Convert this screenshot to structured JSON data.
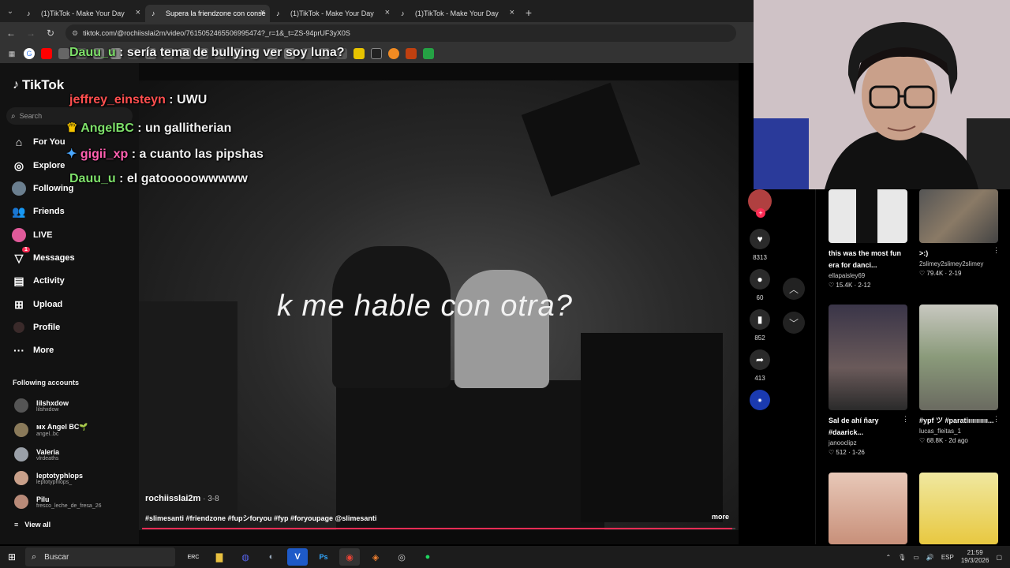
{
  "browser": {
    "tabs": [
      {
        "label": "(1)TikTok - Make Your Day",
        "active": false
      },
      {
        "label": "Supera la friendzone con conse",
        "active": true
      },
      {
        "label": "(1)TikTok - Make Your Day",
        "active": false
      },
      {
        "label": "(1)TikTok - Make Your Day",
        "active": false
      }
    ],
    "url": "tiktok.com/@rochiisslai2m/video/7615052465506995474?_r=1&_t=ZS-94prUF3yX0S"
  },
  "sidebar": {
    "logo": "TikTok",
    "search_placeholder": "Search",
    "nav": [
      {
        "label": "For You",
        "icon": "home-icon"
      },
      {
        "label": "Explore",
        "icon": "compass-icon"
      },
      {
        "label": "Following",
        "icon": "following-avatar-icon"
      },
      {
        "label": "Friends",
        "icon": "friends-icon"
      },
      {
        "label": "LIVE",
        "icon": "live-icon"
      },
      {
        "label": "Messages",
        "icon": "messages-icon",
        "badge": "1"
      },
      {
        "label": "Activity",
        "icon": "activity-icon"
      },
      {
        "label": "Upload",
        "icon": "upload-icon"
      },
      {
        "label": "Profile",
        "icon": "profile-icon"
      },
      {
        "label": "More",
        "icon": "more-dots-icon"
      }
    ],
    "following_header": "Following accounts",
    "accounts": [
      {
        "name": "lilshxdow",
        "handle": "lilshxdow"
      },
      {
        "name": "ᴍx Angel BC🌱",
        "handle": "angel..bc"
      },
      {
        "name": "Valeria",
        "handle": "vlrdeaths"
      },
      {
        "name": "leptotyphlops",
        "handle": "leptotyphlops_"
      },
      {
        "name": "Pilu",
        "handle": "fresco_leche_de_fresa_26"
      }
    ],
    "view_all": "View all"
  },
  "chat": [
    {
      "user": "Dauu_u",
      "message": ": sería tema de bullying ver soy luna?",
      "color": "#7ee06a"
    },
    {
      "user": "jeffrey_einsteyn",
      "message": ": UWU",
      "color": "#ff4f4f"
    },
    {
      "user": "AngelBC",
      "message": ": un gallitherian",
      "color": "#7ee06a"
    },
    {
      "user": "gigii_xp",
      "message": ": a cuanto las pipshas",
      "color": "#ff5fb0"
    },
    {
      "user": "Dauu_u",
      "message": ": el gatooooowwwww",
      "color": "#7ee06a"
    }
  ],
  "video": {
    "overlay_text": "k me hable con otra?",
    "author": "rochiisslai2m",
    "date": " · 3-8",
    "hashtags": "#slimesanti #friendzone #fupシforyou #fyp #foryoupage @slimesanti",
    "more": "more",
    "progress": 0.995
  },
  "actions": {
    "likes": "8313",
    "comments": "60",
    "saves": "852",
    "shares": "413"
  },
  "related": [
    {
      "title": "this was the most fun era for danci...",
      "user": "ellapaisley69",
      "meta": "♡ 15.4K · 2-12"
    },
    {
      "title": ">:)",
      "user": "2slimey2slimey2slimey",
      "meta": "♡ 79.4K · 2-19"
    },
    {
      "title": "Sal de ahí ñary #daarick...",
      "user": "janooclipz",
      "meta": "♡ 512 · 1-26"
    },
    {
      "title": "#ypf ツ #paratiıııııııııı...",
      "user": "lucas_fleitas_1",
      "meta": "♡ 68.8K · 2d ago"
    },
    {
      "title": "",
      "user": "",
      "meta": ""
    },
    {
      "title": "",
      "user": "",
      "meta": ""
    }
  ],
  "taskbar": {
    "search": "Buscar",
    "lang": "ESP",
    "time": "21:59",
    "date": "19/3/2026"
  },
  "colors": {
    "accent": "#fe2c55",
    "page_bg": "#121212"
  }
}
